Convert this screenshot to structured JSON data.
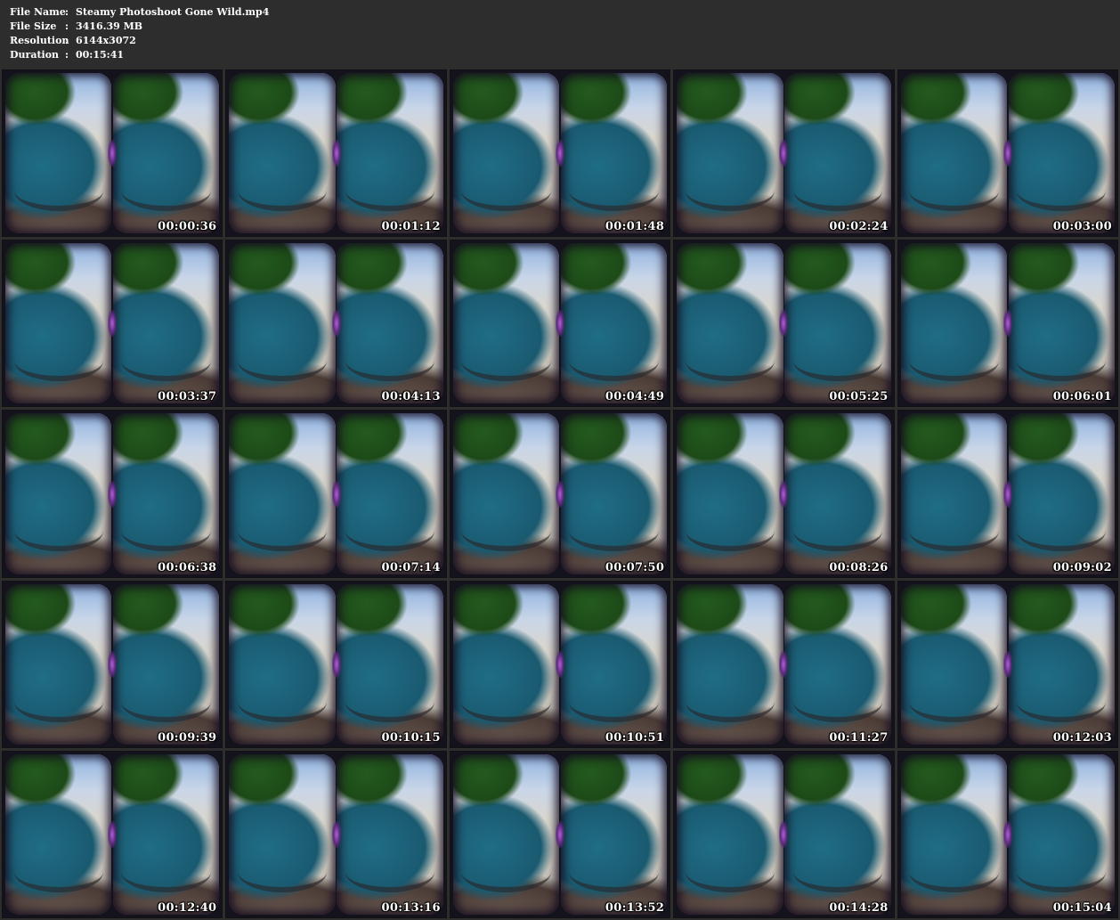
{
  "file_info": [
    {
      "label": "File Name",
      "value": "Steamy Photoshoot Gone Wild.mp4"
    },
    {
      "label": "File Size",
      "value": "3416.39 MB"
    },
    {
      "label": "Resolution",
      "value": "6144x3072"
    },
    {
      "label": "Duration",
      "value": "00:15:41"
    }
  ],
  "separator": ":",
  "thumbnails": [
    "00:00:36",
    "00:01:12",
    "00:01:48",
    "00:02:24",
    "00:03:00",
    "00:03:37",
    "00:04:13",
    "00:04:49",
    "00:05:25",
    "00:06:01",
    "00:06:38",
    "00:07:14",
    "00:07:50",
    "00:08:26",
    "00:09:02",
    "00:09:39",
    "00:10:15",
    "00:10:51",
    "00:11:27",
    "00:12:03",
    "00:12:40",
    "00:13:16",
    "00:13:52",
    "00:14:28",
    "00:15:04"
  ],
  "colors": {
    "background": "#2d2d2d",
    "text": "#ffffff",
    "seam_accent": "#b060d8"
  }
}
